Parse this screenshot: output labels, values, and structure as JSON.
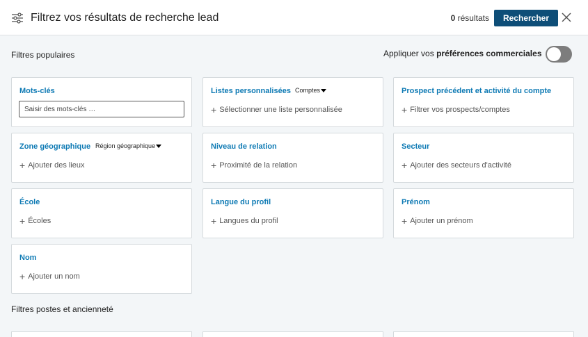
{
  "header": {
    "title": "Filtrez vos résultats de recherche lead",
    "results_count": "0",
    "results_label": "résultats",
    "search_button": "Rechercher"
  },
  "sections": {
    "popular": "Filtres populaires",
    "positions": "Filtres postes et ancienneté"
  },
  "preferences": {
    "label_prefix": "Appliquer vos",
    "label_bold": "préférences commerciales",
    "toggle_on": false
  },
  "cards": {
    "keywords": {
      "title": "Mots-clés",
      "placeholder": "Saisir des mots-clés …"
    },
    "custom_lists": {
      "title": "Listes personnalisées",
      "dropdown": "Comptes",
      "add": "Sélectionner une liste personnalisée"
    },
    "prior_prospect": {
      "title": "Prospect précédent et activité du compte",
      "add": "Filtrer vos prospects/comptes"
    },
    "geography": {
      "title": "Zone géographique",
      "dropdown": "Région géographique",
      "add": "Ajouter des lieux"
    },
    "relationship": {
      "title": "Niveau de relation",
      "add": "Proximité de la relation"
    },
    "sector": {
      "title": "Secteur",
      "add": "Ajouter des secteurs d'activité"
    },
    "school": {
      "title": "École",
      "add": "Écoles"
    },
    "profile_language": {
      "title": "Langue du profil",
      "add": "Langues du profil"
    },
    "first_name": {
      "title": "Prénom",
      "add": "Ajouter un prénom"
    },
    "last_name": {
      "title": "Nom",
      "add": "Ajouter un nom"
    }
  },
  "colors": {
    "accent": "#0e7ab4",
    "button": "#0e4e78",
    "background": "#f3f6f8"
  }
}
